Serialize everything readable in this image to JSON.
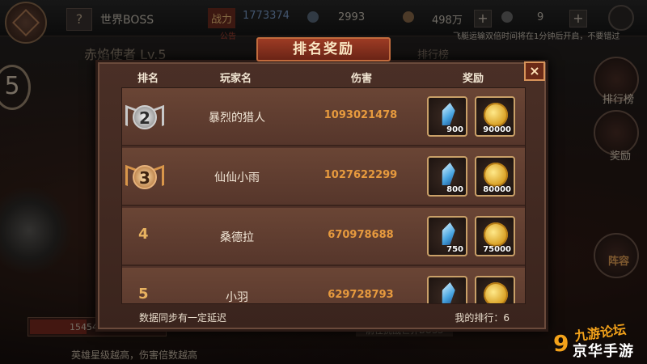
{
  "hud": {
    "help_icon_text": "?",
    "boss_label": "世界BOSS",
    "power_label": "战力",
    "power_value": "1773374",
    "notice_label": "公告",
    "gem_value": "2993",
    "gold_value": "498万",
    "energy_value": "9",
    "plus_text": "+",
    "scroll_message": "飞艇运输双倍时间将在1分钟后开启，不要错过",
    "player_title": "赤焰使者  Lv.5",
    "left_number": "5",
    "bottom_progress_value": "15454",
    "bottom_hint": "英雄星级越高，伤害倍数越高",
    "behind_modal_button": "排行榜",
    "behind_modal_bottom": "前往挑战世界BOSS"
  },
  "side_buttons": [
    {
      "label": "排行榜"
    },
    {
      "label": "奖励"
    },
    {
      "label": "阵容"
    }
  ],
  "modal": {
    "title": "排名奖励",
    "close_label": "×",
    "headers": {
      "rank": "排名",
      "player": "玩家名",
      "damage": "伤害",
      "reward": "奖励"
    },
    "rows": [
      {
        "rank": "2",
        "rank_style": "silver",
        "player": "暴烈的猎人",
        "damage": "1093021478",
        "crystal_qty": "900",
        "coin_qty": "90000"
      },
      {
        "rank": "3",
        "rank_style": "bronze",
        "player": "仙仙小雨",
        "damage": "1027622299",
        "crystal_qty": "800",
        "coin_qty": "80000"
      },
      {
        "rank": "4",
        "rank_style": "plain",
        "player": "桑德拉",
        "damage": "670978688",
        "crystal_qty": "750",
        "coin_qty": "75000"
      },
      {
        "rank": "5",
        "rank_style": "plain",
        "player": "小羽",
        "damage": "629728793",
        "crystal_qty": "",
        "coin_qty": ""
      }
    ],
    "footer_note": "数据同步有一定延迟",
    "my_rank": "我的排行：6"
  },
  "watermark": {
    "top": "九游论坛",
    "bottom": "京华手游",
    "digit": "9"
  },
  "colors": {
    "title_bar": "#9d3b24",
    "damage_text": "#e79a3e",
    "modal_bg": "#3a241d"
  }
}
